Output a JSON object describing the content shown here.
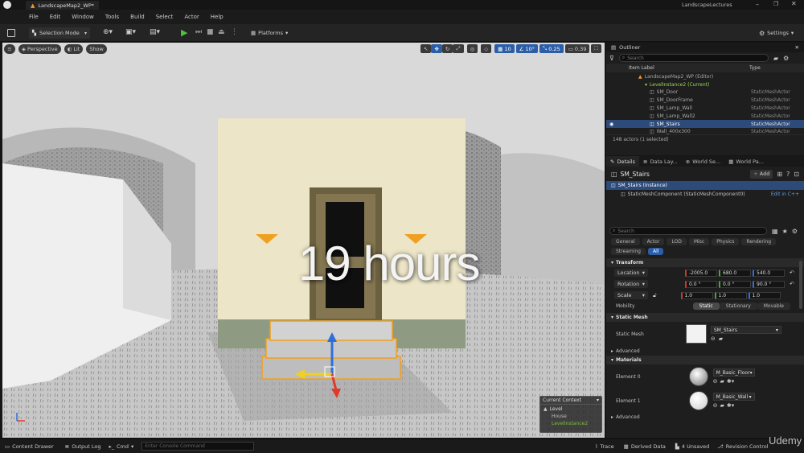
{
  "titlebar": {
    "tab_label": "LandscapeMap2_WP*",
    "project": "LandscapeLectures"
  },
  "menu": [
    "File",
    "Edit",
    "Window",
    "Tools",
    "Build",
    "Select",
    "Actor",
    "Help"
  ],
  "toolbar": {
    "mode": "Selection Mode",
    "platforms": "Platforms",
    "settings": "Settings"
  },
  "viewport": {
    "perspective": "Perspective",
    "lit": "Lit",
    "show": "Show",
    "grid_snap": "10",
    "rot_snap": "10°",
    "scale_snap": "0.25",
    "cam_speed": "0.39",
    "overlay": "19 hours",
    "context": {
      "header": "Current Context",
      "level": "Level",
      "house": "House",
      "instance": "LevelInstance2"
    }
  },
  "outliner": {
    "tab": "Outliner",
    "search_placeholder": "Search",
    "col_label": "Item Label",
    "col_type": "Type",
    "root": "LandscapeMap2_WP (Editor)",
    "current": "LevelInstance2 (Current)",
    "rows": [
      {
        "name": "SM_Door",
        "type": "StaticMeshActor"
      },
      {
        "name": "SM_DoorFrame",
        "type": "StaticMeshActor"
      },
      {
        "name": "SM_Lamp_Wall",
        "type": "StaticMeshActor"
      },
      {
        "name": "SM_Lamp_Wall2",
        "type": "StaticMeshActor"
      },
      {
        "name": "SM_Stairs",
        "type": "StaticMeshActor"
      },
      {
        "name": "Wall_400x300",
        "type": "StaticMeshActor"
      }
    ],
    "count": "148 actors (1 selected)"
  },
  "details": {
    "tabs": [
      "Details",
      "Data Lay...",
      "World Se...",
      "World Pa..."
    ],
    "actor": "SM_Stairs",
    "add": "Add",
    "instance": "SM_Stairs (Instance)",
    "component": "StaticMeshComponent (StaticMeshComponent0)",
    "edit_cpp": "Edit in C++",
    "search_placeholder": "Search",
    "categories": [
      "General",
      "Actor",
      "LOD",
      "Misc",
      "Physics",
      "Rendering",
      "Streaming",
      "All"
    ],
    "transform": "Transform",
    "location_label": "Location",
    "location": [
      "-2005.0",
      "680.0",
      "540.0"
    ],
    "rotation_label": "Rotation",
    "rotation": [
      "0.0 °",
      "0.0 °",
      "90.0 °"
    ],
    "scale_label": "Scale",
    "scale": [
      "1.0",
      "1.0",
      "1.0"
    ],
    "mobility_label": "Mobility",
    "mobility": [
      "Static",
      "Stationary",
      "Movable"
    ],
    "static_mesh_section": "Static Mesh",
    "static_mesh_label": "Static Mesh",
    "static_mesh_value": "SM_Stairs",
    "advanced": "Advanced",
    "materials": "Materials",
    "element0_label": "Element 0",
    "element0_value": "M_Basic_Floor",
    "element1_label": "Element 1",
    "element1_value": "M_Basic_Wall",
    "advanced2": "Advanced"
  },
  "statusbar": {
    "content_drawer": "Content Drawer",
    "output_log": "Output Log",
    "cmd": "Cmd",
    "console_placeholder": "Enter Console Command",
    "trace": "Trace",
    "derived": "Derived Data",
    "unsaved": "4 Unsaved",
    "revision": "Revision Control",
    "watermark": "Udemy"
  },
  "colors": {
    "accent_blue": "#2c5ea8",
    "selection": "#2c4a7a",
    "play_green": "#4fbf3f",
    "gizmo_blue": "#2f6fd8",
    "gizmo_red": "#e03a2a",
    "gizmo_yellow": "#f0d020"
  }
}
